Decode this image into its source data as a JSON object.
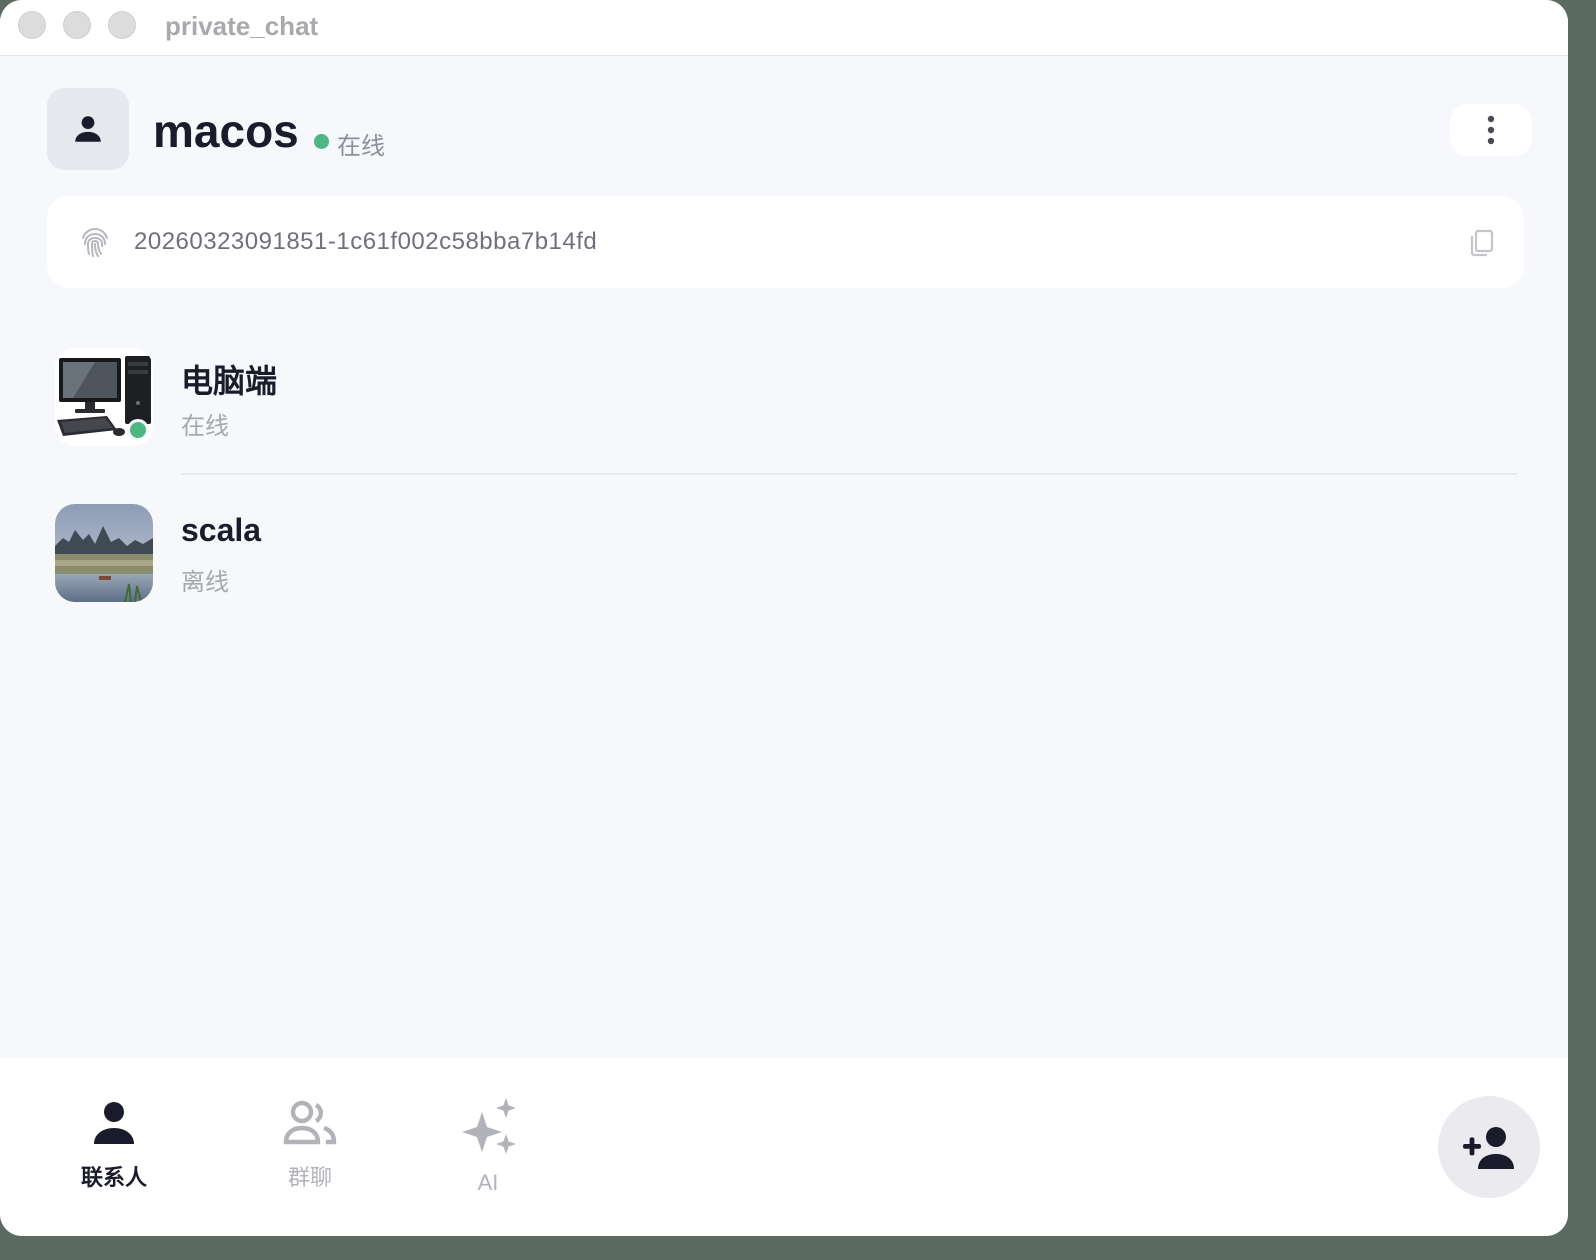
{
  "window": {
    "title": "private_chat"
  },
  "profile": {
    "username": "macos",
    "status": "在线",
    "user_id": "20260323091851-1c61f002c58bba7b14fd"
  },
  "contacts": [
    {
      "name": "电脑端",
      "status": "在线",
      "online": true,
      "avatar": "desktop-computer"
    },
    {
      "name": "scala",
      "status": "离线",
      "online": false,
      "avatar": "landscape-photo"
    }
  ],
  "tabs": [
    {
      "label": "联系人",
      "icon": "person-icon",
      "active": true
    },
    {
      "label": "群聊",
      "icon": "people-icon",
      "active": false
    },
    {
      "label": "AI",
      "icon": "sparkles-icon",
      "active": false
    }
  ],
  "colors": {
    "online": "#4cb782",
    "text": "#1b1c2b",
    "muted": "#a7a8ae",
    "background": "#f7f8fc"
  }
}
